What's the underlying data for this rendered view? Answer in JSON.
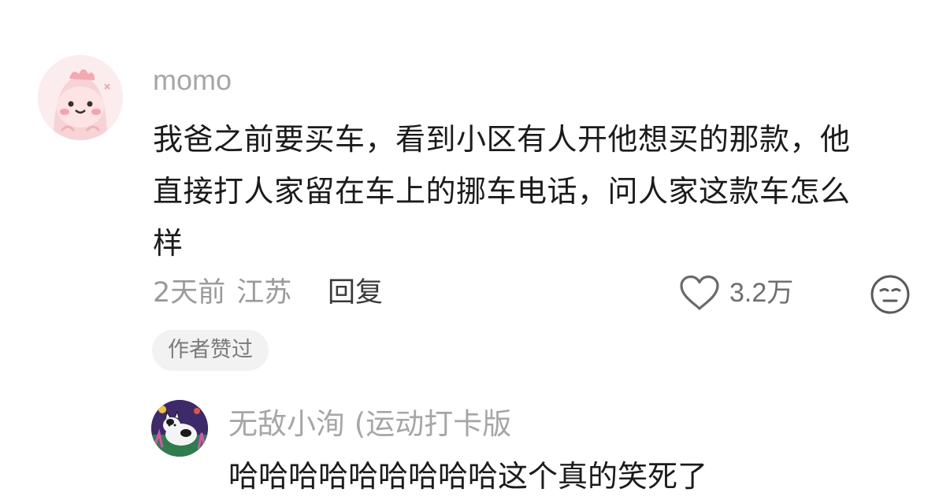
{
  "comment": {
    "username": "momo",
    "lines": [
      "我爸之前要买车，看到小区有人开他想买的那款，他",
      "直接打人家留在车上的挪车电话，问人家这款车怎么",
      "样"
    ],
    "time": "2天前",
    "location": "江苏",
    "reply_label": "回复",
    "like_count": "3.2万",
    "author_badge": "作者赞过"
  },
  "reply": {
    "username": "无敌小洵 (运动打卡版",
    "text": "哈哈哈哈哈哈哈哈哈这个真的笑死了"
  },
  "icons": {
    "like": "heart-outline-icon",
    "dislike": "unamused-face-icon"
  },
  "colors": {
    "secondary_text": "#a6a6a6",
    "primary_text": "#1b1b1b",
    "badge_bg": "#f2f2f2"
  }
}
